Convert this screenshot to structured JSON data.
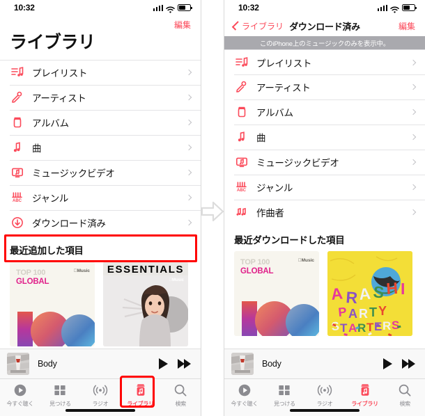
{
  "colors": {
    "accent": "#fb4a5a",
    "highlight": "#ff0000",
    "banner_bg": "#a9a9ae",
    "separator": "#e3e3e6",
    "chevron": "#c2c2c6",
    "tab_inactive": "#8b8b90"
  },
  "status_bar": {
    "time": "10:32",
    "signal_icon": "cellular-signal-icon",
    "wifi_icon": "wifi-icon",
    "battery_icon": "battery-icon"
  },
  "left_phone": {
    "edit_label": "編集",
    "page_title": "ライブラリ",
    "list": [
      {
        "label": "プレイリスト",
        "icon": "playlist-icon"
      },
      {
        "label": "アーティスト",
        "icon": "microphone-icon"
      },
      {
        "label": "アルバム",
        "icon": "album-icon"
      },
      {
        "label": "曲",
        "icon": "note-icon"
      },
      {
        "label": "ミュージックビデオ",
        "icon": "music-video-icon"
      },
      {
        "label": "ジャンル",
        "icon": "genre-icon"
      },
      {
        "label": "ダウンロード済み",
        "icon": "download-circle-icon"
      }
    ],
    "section_heading": "最近追加した項目",
    "albums": [
      {
        "artwork": "top100-global-artwork",
        "line1": "TOP 100",
        "line2": "GLOBAL",
        "badge": "Music"
      },
      {
        "artwork": "essentials-artwork",
        "word": "ESSENTIALS",
        "badge": "Music"
      }
    ]
  },
  "right_phone": {
    "back_label": "ライブラリ",
    "nav_title": "ダウンロード済み",
    "edit_label": "編集",
    "banner": "このiPhone上のミュージックのみを表示中。",
    "list": [
      {
        "label": "プレイリスト",
        "icon": "playlist-icon"
      },
      {
        "label": "アーティスト",
        "icon": "microphone-icon"
      },
      {
        "label": "アルバム",
        "icon": "album-icon"
      },
      {
        "label": "曲",
        "icon": "note-icon"
      },
      {
        "label": "ミュージックビデオ",
        "icon": "music-video-icon"
      },
      {
        "label": "ジャンル",
        "icon": "genre-icon"
      },
      {
        "label": "作曲者",
        "icon": "composer-icon"
      }
    ],
    "section_heading": "最近ダウンロードした項目",
    "albums": [
      {
        "artwork": "top100-global-artwork",
        "line1": "TOP 100",
        "line2": "GLOBAL",
        "badge": "Music"
      },
      {
        "artwork": "arashi-party-starters-artwork",
        "word": "ARASHI PARTY STARTERS"
      }
    ]
  },
  "mini_player": {
    "artwork": "now-playing-artwork",
    "title": "Body",
    "play_icon": "play-icon",
    "next_icon": "fast-forward-icon"
  },
  "tab_bar": {
    "tabs": [
      {
        "label": "今すぐ聴く",
        "icon": "listen-now-icon",
        "active": false
      },
      {
        "label": "見つける",
        "icon": "browse-icon",
        "active": false
      },
      {
        "label": "ラジオ",
        "icon": "radio-icon",
        "active": false
      },
      {
        "label": "ライブラリ",
        "icon": "library-icon",
        "active": true
      },
      {
        "label": "検索",
        "icon": "search-icon",
        "active": false
      }
    ]
  },
  "annotations": {
    "transition_arrow": "right-arrow-icon",
    "highlight_download_row": "ダウンロード済み",
    "highlight_library_tab": "ライブラリ"
  }
}
